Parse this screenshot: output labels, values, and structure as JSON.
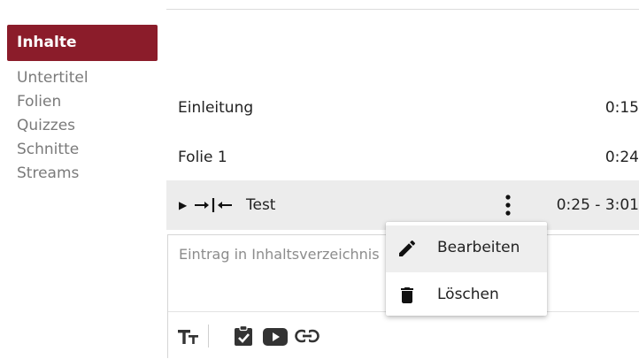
{
  "sidebar": {
    "items": [
      {
        "label": "Inhalte",
        "active": true
      },
      {
        "label": "Untertitel"
      },
      {
        "label": "Folien"
      },
      {
        "label": "Quizzes"
      },
      {
        "label": "Schnitte"
      },
      {
        "label": "Streams"
      }
    ]
  },
  "content": {
    "rows": [
      {
        "label": "Einleitung",
        "time": "0:15"
      },
      {
        "label": "Folie 1",
        "time": "0:24"
      },
      {
        "label": "Test",
        "time": "0:25 - 3:01",
        "icons": [
          "expand-arrow-icon",
          "cut-icon",
          "kebab-menu-icon"
        ]
      }
    ]
  },
  "editor": {
    "placeholder": "Eintrag in Inhaltsverzeichnis",
    "toolbar_icons": [
      "text-format-icon",
      "quiz-clipboard-icon",
      "youtube-icon",
      "link-icon"
    ]
  },
  "context_menu": {
    "items": [
      {
        "label": "Bearbeiten",
        "icon": "pencil-icon",
        "hover": true
      },
      {
        "label": "Löschen",
        "icon": "trash-icon"
      }
    ]
  },
  "colors": {
    "accent": "#8b1c2a",
    "row_highlight": "#ececec",
    "muted_text": "#7a7a7a"
  }
}
